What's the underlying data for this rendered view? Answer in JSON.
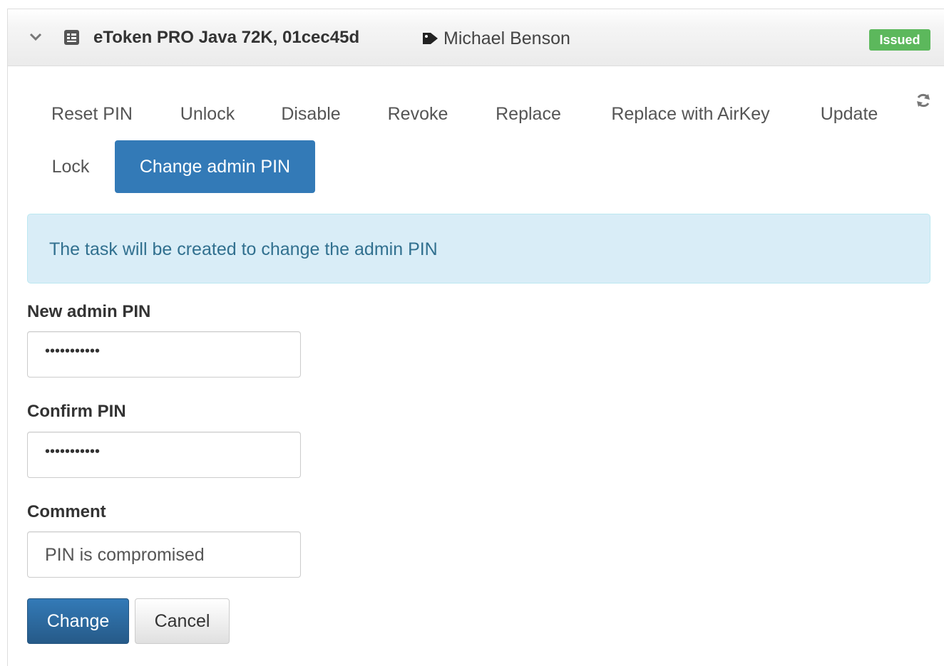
{
  "header": {
    "token_title": "eToken PRO Java 72K, 01cec45d",
    "owner_name": "Michael Benson",
    "status_badge": "Issued",
    "icons": [
      "chevron-down-icon",
      "token-icon",
      "tag-icon"
    ]
  },
  "actions": {
    "reset_pin": "Reset PIN",
    "unlock": "Unlock",
    "disable": "Disable",
    "revoke": "Revoke",
    "replace": "Replace",
    "replace_airkey": "Replace with AirKey",
    "update": "Update",
    "lock": "Lock",
    "change_admin_pin": "Change admin PIN",
    "active": "Change admin PIN",
    "refresh_icon": "refresh-icon"
  },
  "alert": {
    "text": "The task will be created to change the admin PIN"
  },
  "form": {
    "new_pin_label": "New admin PIN",
    "new_pin_value": "•••••••••••",
    "confirm_pin_label": "Confirm PIN",
    "confirm_pin_value": "•••••••••••",
    "comment_label": "Comment",
    "comment_value": "PIN is compromised"
  },
  "buttons": {
    "change": "Change",
    "cancel": "Cancel"
  },
  "colors": {
    "primary": "#337ab7",
    "success": "#5cb85c",
    "info_bg": "#d9edf7",
    "info_text": "#31708f"
  }
}
